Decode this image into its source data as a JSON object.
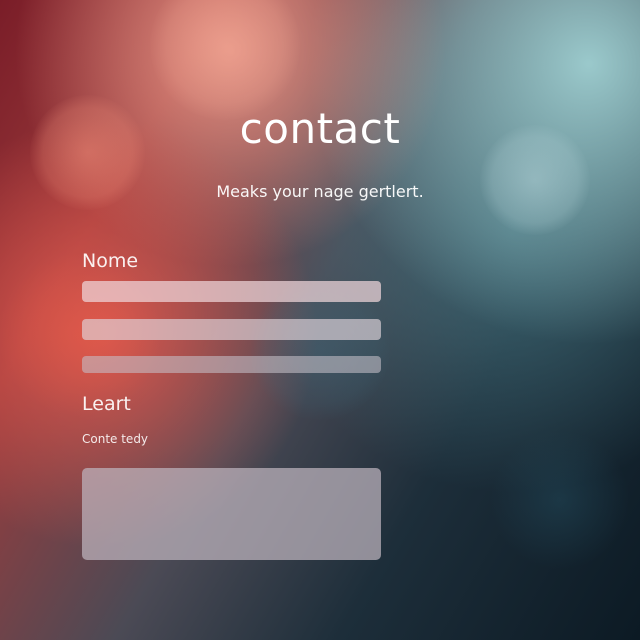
{
  "header": {
    "title": "contact",
    "subtitle": "Meaks your nage gertlert."
  },
  "form": {
    "name_label": "Nome",
    "fields": [
      {
        "value": "",
        "placeholder": ""
      },
      {
        "value": "",
        "placeholder": ""
      },
      {
        "value": "",
        "placeholder": ""
      }
    ],
    "second_label": "Leart",
    "hint": "Conte tedy",
    "message": {
      "value": "",
      "placeholder": ""
    }
  },
  "colors": {
    "background_left": "#9a3b3c",
    "background_right": "#0c1a24",
    "field_fill": "#eed6da",
    "text": "#ffffff"
  }
}
